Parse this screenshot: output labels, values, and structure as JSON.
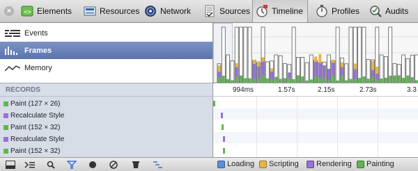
{
  "toolbar": {
    "tabs": [
      {
        "label": "Elements",
        "icon": "elements-icon"
      },
      {
        "label": "Resources",
        "icon": "resources-icon"
      },
      {
        "label": "Network",
        "icon": "network-icon"
      },
      {
        "label": "Sources",
        "icon": "sources-icon"
      },
      {
        "label": "Timeline",
        "icon": "timeline-icon",
        "active": true
      },
      {
        "label": "Profiles",
        "icon": "profiles-icon"
      },
      {
        "label": "Audits",
        "icon": "audits-icon"
      }
    ]
  },
  "overview": {
    "items": [
      {
        "label": "Events"
      },
      {
        "label": "Frames",
        "selected": true
      },
      {
        "label": "Memory"
      }
    ]
  },
  "records": {
    "header": "RECORDS",
    "ticks": [
      "994ms",
      "1.57s",
      "2.15s",
      "2.73s",
      "3.3"
    ],
    "rows": [
      {
        "label": "Paint (127 × 26)",
        "category": "painting"
      },
      {
        "label": "Recalculate Style",
        "category": "rendering"
      },
      {
        "label": "Paint (152 × 32)",
        "category": "painting"
      },
      {
        "label": "Recalculate Style",
        "category": "rendering"
      },
      {
        "label": "Paint (152 × 32)",
        "category": "painting"
      }
    ]
  },
  "legend": {
    "items": [
      {
        "label": "Loading",
        "color": "#5a8fd8"
      },
      {
        "label": "Scripting",
        "color": "#e9b446"
      },
      {
        "label": "Rendering",
        "color": "#9472d6"
      },
      {
        "label": "Painting",
        "color": "#60b650"
      }
    ]
  },
  "colors": {
    "rendering": "#9472d6",
    "painting": "#60b650",
    "scripting": "#e9b446",
    "selected": "#6a82b9"
  }
}
